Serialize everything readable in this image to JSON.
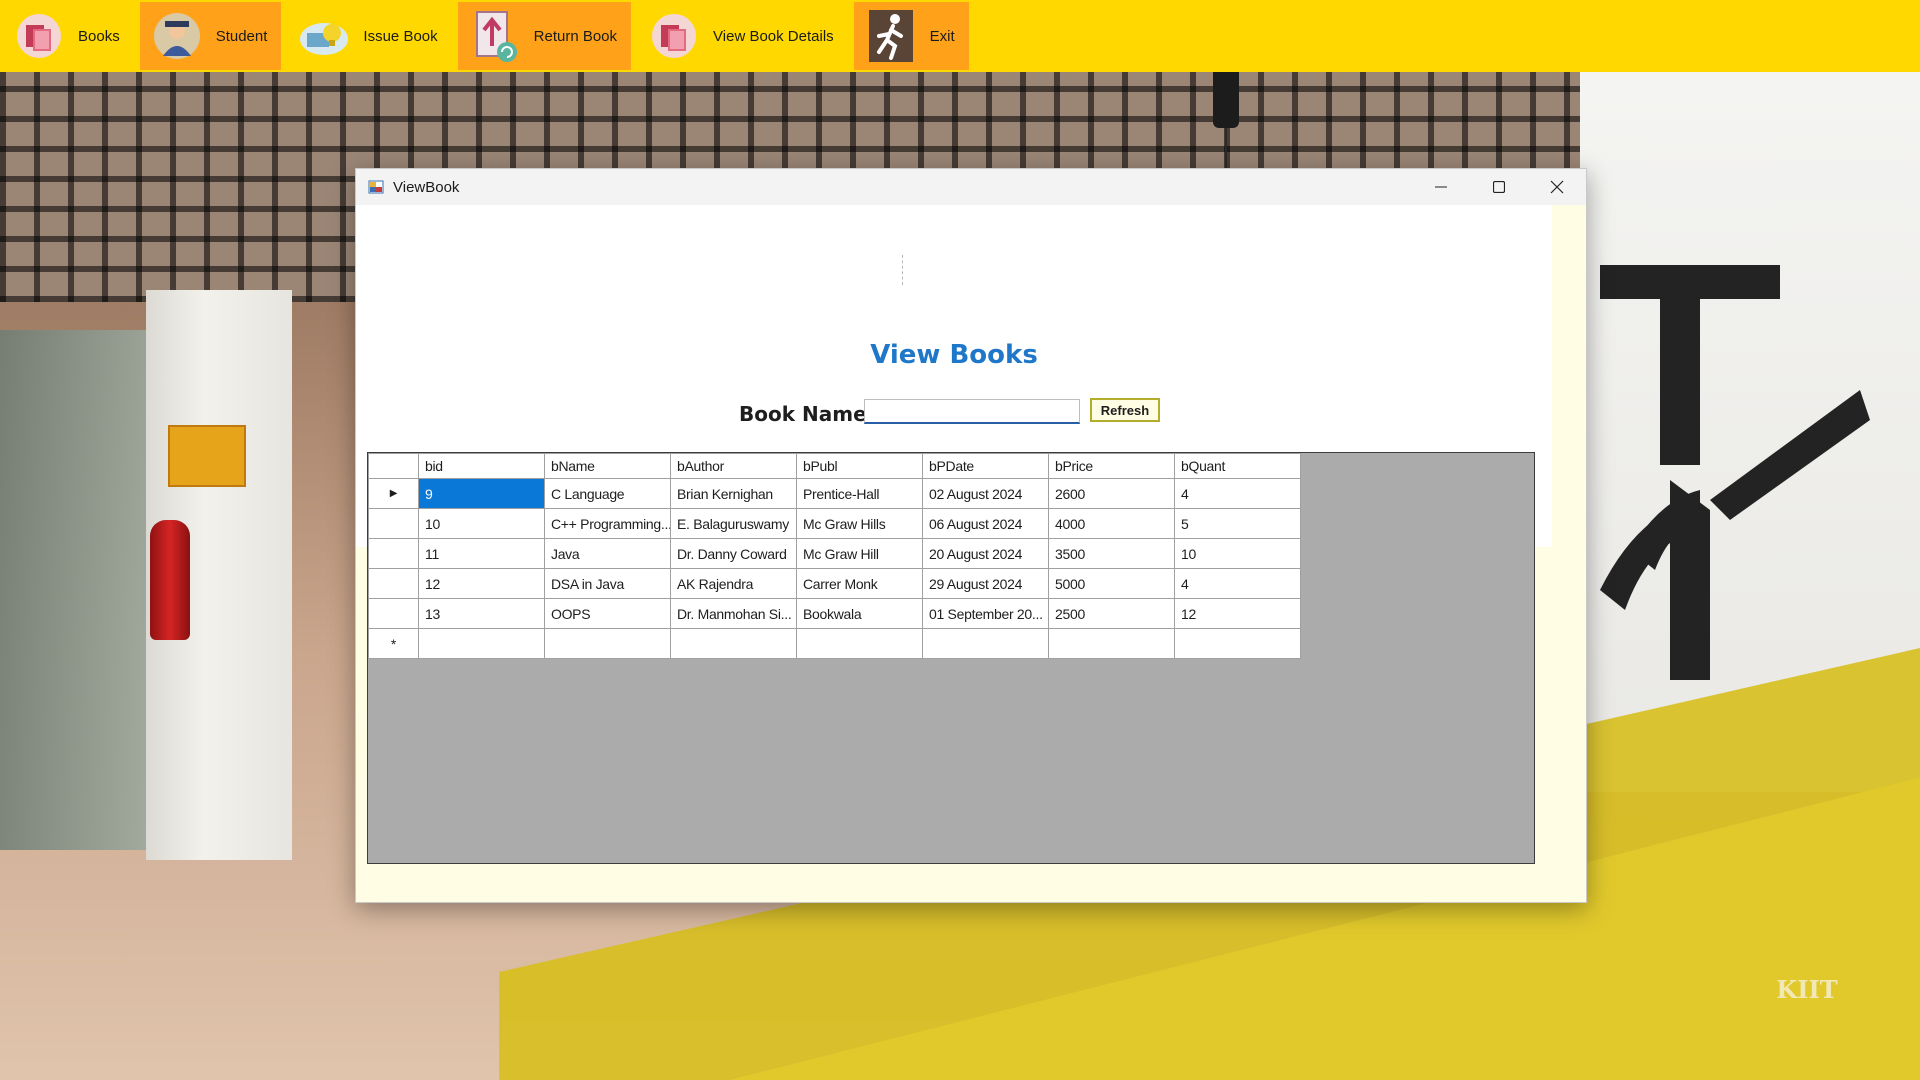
{
  "menu": {
    "items": [
      {
        "label": "Books",
        "icon": "books-icon",
        "active": false
      },
      {
        "label": "Student",
        "icon": "student-icon",
        "active": true
      },
      {
        "label": "Issue Book",
        "icon": "issue-book-icon",
        "active": false
      },
      {
        "label": "Return Book",
        "icon": "return-book-icon",
        "active": true
      },
      {
        "label": "View Book Details",
        "icon": "view-book-details-icon",
        "active": false
      },
      {
        "label": "Exit",
        "icon": "exit-icon",
        "active": true
      }
    ],
    "bar_color": "#ffd800",
    "active_color": "#ffa21a"
  },
  "window": {
    "title": "ViewBook",
    "page_title": "View Books",
    "search_label": "Book Name",
    "search_value": "",
    "refresh_label": "Refresh",
    "accent_color": "#1e77c8",
    "selection_color": "#0a78d7"
  },
  "grid": {
    "columns": [
      "bid",
      "bName",
      "bAuthor",
      "bPubl",
      "bPDate",
      "bPrice",
      "bQuant"
    ],
    "rows": [
      [
        "9",
        "C Language",
        "Brian Kernighan",
        "Prentice-Hall",
        "02 August 2024",
        "2600",
        "4"
      ],
      [
        "10",
        "C++ Programming...",
        "E. Balaguruswamy",
        "Mc Graw Hills",
        "06 August 2024",
        "4000",
        "5"
      ],
      [
        "11",
        "Java",
        "Dr. Danny Coward",
        "Mc Graw Hill",
        "20 August 2024",
        "3500",
        "10"
      ],
      [
        "12",
        "DSA in Java",
        "AK Rajendra",
        "Carrer Monk",
        "29 August 2024",
        "5000",
        "4"
      ],
      [
        "13",
        "OOPS",
        "Dr. Manmohan Si...",
        "Bookwala",
        "01 September 20...",
        "2500",
        "12"
      ]
    ],
    "current_row_marker": "▶",
    "new_row_marker": "*"
  },
  "background": {
    "seal_text": "KIIT"
  }
}
